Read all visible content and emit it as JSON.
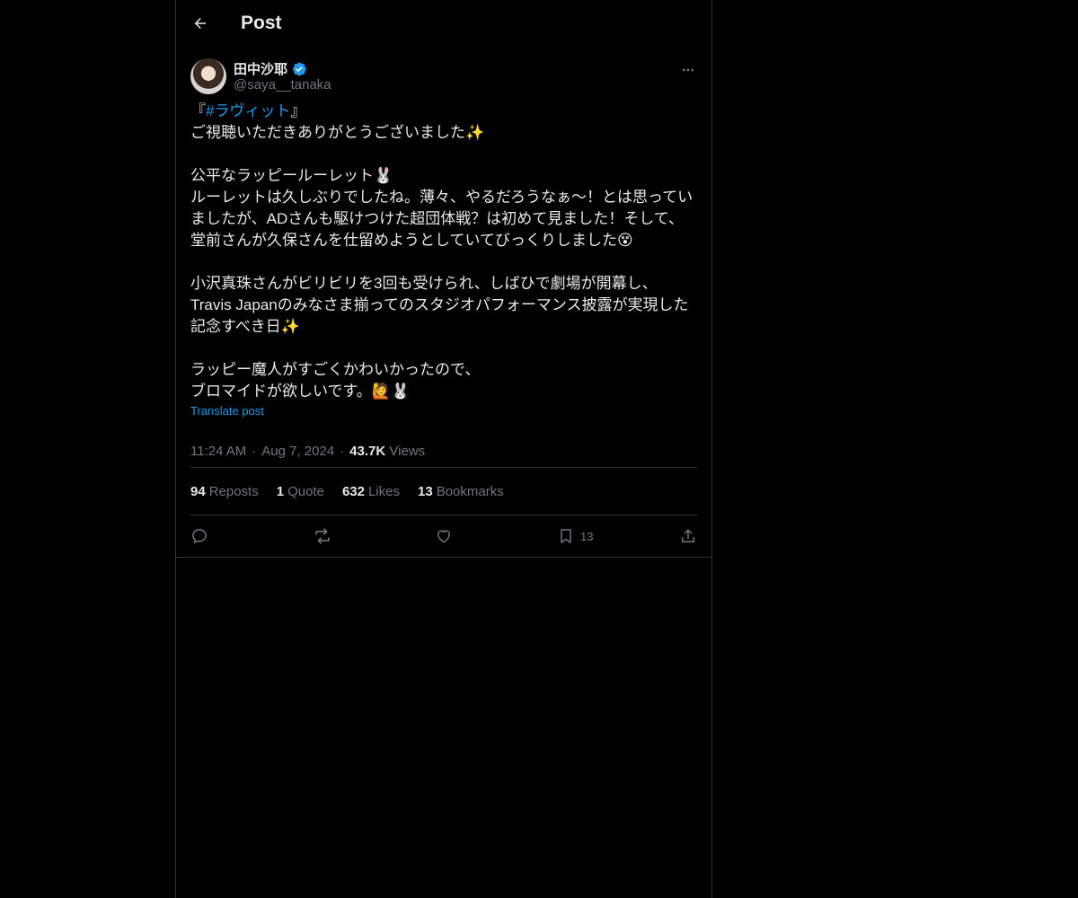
{
  "header": {
    "title": "Post"
  },
  "author": {
    "name": "田中沙耶",
    "handle": "@saya__tanaka"
  },
  "post": {
    "line_open": "『",
    "hashtag": "#ラヴィット",
    "line_close": "』",
    "body": "ご視聴いただきありがとうございました✨\n\n公平なラッピールーレット🐰\nルーレットは久しぶりでしたね。薄々、やるだろうなぁ〜！とは思っていましたが、ADさんも駆けつけた超団体戦？は初めて見ました！そして、堂前さんが久保さんを仕留めようとしていてびっくりしました😵\n\n小沢真珠さんがビリビリを3回も受けられ、しばひで劇場が開幕し、\nTravis Japanのみなさま揃ってのスタジオパフォーマンス披露が実現した記念すべき日✨\n\nラッピー魔人がすごくかわいかったので、\nブロマイドが欲しいです。🙋🐰",
    "translate": "Translate post",
    "time": "11:24 AM",
    "date": "Aug 7, 2024",
    "views_count": "43.7K",
    "views_label": "Views"
  },
  "stats": {
    "reposts_count": "94",
    "reposts_label": "Reposts",
    "quotes_count": "1",
    "quotes_label": "Quote",
    "likes_count": "632",
    "likes_label": "Likes",
    "bookmarks_count": "13",
    "bookmarks_label": "Bookmarks"
  },
  "actions": {
    "bookmark_count": "13"
  },
  "colors": {
    "accent": "#1d9bf0",
    "background": "#000000",
    "muted": "#71767b",
    "text": "#e7e9ea"
  }
}
